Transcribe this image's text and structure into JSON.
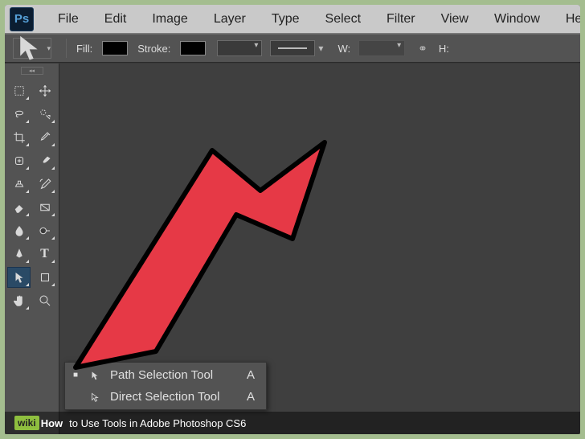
{
  "app": {
    "logo_text": "Ps"
  },
  "menu": [
    "File",
    "Edit",
    "Image",
    "Layer",
    "Type",
    "Select",
    "Filter",
    "View",
    "Window",
    "Help"
  ],
  "options": {
    "fill_label": "Fill:",
    "stroke_label": "Stroke:",
    "w_label": "W:",
    "h_label": "H:",
    "link_glyph": "⚭"
  },
  "flyout": {
    "items": [
      {
        "label": "Path Selection Tool",
        "shortcut": "A",
        "selected": true
      },
      {
        "label": "Direct Selection Tool",
        "shortcut": "A",
        "selected": false
      }
    ]
  },
  "caption": {
    "wiki_prefix": "wiki",
    "wiki_suffix": "How",
    "text": "to Use Tools in Adobe Photoshop CS6"
  }
}
